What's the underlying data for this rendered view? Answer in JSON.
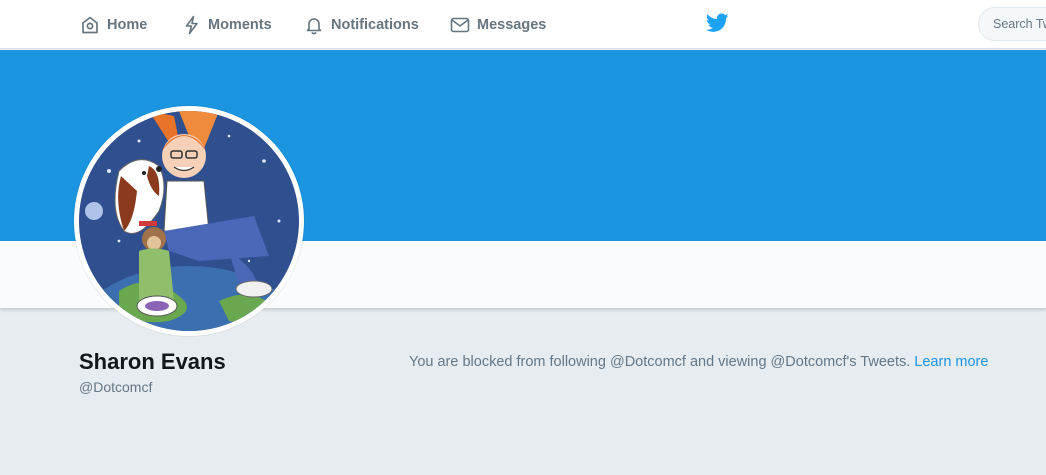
{
  "nav": {
    "items": [
      {
        "label": "Home",
        "icon": "home-icon"
      },
      {
        "label": "Moments",
        "icon": "lightning-icon"
      },
      {
        "label": "Notifications",
        "icon": "bell-icon"
      },
      {
        "label": "Messages",
        "icon": "envelope-icon"
      }
    ],
    "logo_icon": "twitter-bird-icon",
    "search_placeholder": "Search Twitter"
  },
  "profile": {
    "full_name": "Sharon Evans",
    "screen_name": "@Dotcomcf",
    "avatar_icon": "profile-avatar",
    "blocked_message": "You are blocked from following @Dotcomcf and viewing @Dotcomcf's Tweets.",
    "learn_more": "Learn more"
  },
  "colors": {
    "accent": "#1b95e0",
    "banner": "#1b95e0",
    "page_background": "#e6ecf0",
    "muted_text": "#657786"
  }
}
